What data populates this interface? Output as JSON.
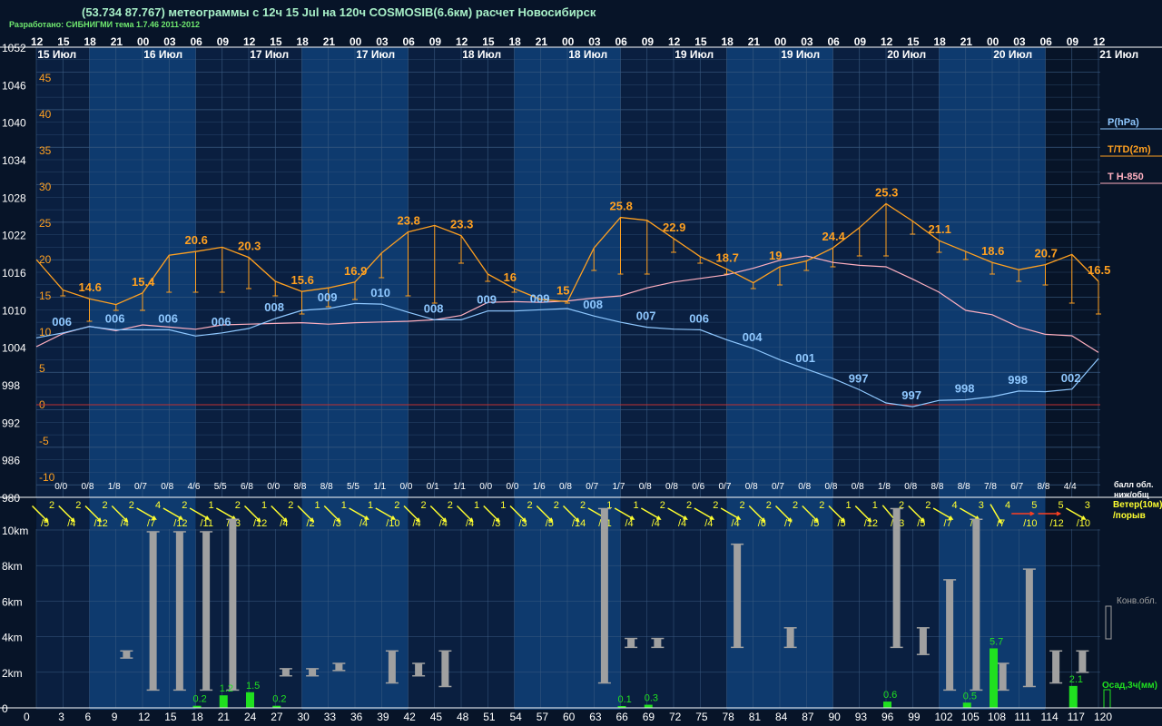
{
  "header": {
    "title": "(53.734 87.767) метеограммы с  12ч 15 Jul на 120ч COSMOSIB(6.6км) расчет Новосибирск",
    "subtitle": "Разработано: СИБНИГМИ тема 1.7.46 2011-2012"
  },
  "colors": {
    "background": "#071428",
    "band_light": "#0e3a6e",
    "band_dark": "#0a1f40",
    "pressure": "#8fc8ff",
    "temperature": "#ffa020",
    "t850": "#ffb0c0",
    "zero_line": "#c03030",
    "grid": "#3a5a80",
    "wind_yellow": "#ffff30",
    "wind_red": "#ff4020",
    "cloud": "#a0a0a0",
    "precip": "#20e020"
  },
  "chart_data": {
    "type": "line",
    "hour_ticks": [
      "12",
      "15",
      "18",
      "21",
      "00",
      "03",
      "06",
      "09",
      "12",
      "15",
      "18",
      "21",
      "00",
      "03",
      "06",
      "09",
      "12",
      "15",
      "18",
      "21",
      "00",
      "03",
      "06",
      "09",
      "12",
      "15",
      "18",
      "21",
      "00",
      "03",
      "06",
      "09",
      "12",
      "15",
      "18",
      "21",
      "00",
      "03",
      "06",
      "09",
      "12"
    ],
    "date_labels": [
      "15 Июл",
      "16 Июл",
      "17 Июл",
      "17 Июл",
      "18 Июл",
      "18 Июл",
      "19 Июл",
      "19 Июл",
      "20 Июл",
      "20 Июл",
      "21 Июл"
    ],
    "pressure_axis": {
      "ticks": [
        1052,
        1046,
        1040,
        1034,
        1028,
        1022,
        1016,
        1010,
        1004,
        998,
        992,
        986,
        980
      ],
      "range": [
        980,
        1052
      ]
    },
    "temperature_axis": {
      "ticks": [
        45,
        40,
        35,
        30,
        25,
        20,
        15,
        10,
        5,
        0,
        -5,
        -10
      ],
      "range": [
        -10,
        45
      ]
    },
    "lead_hours": [
      0,
      3,
      6,
      9,
      12,
      15,
      18,
      21,
      24,
      27,
      30,
      33,
      36,
      39,
      42,
      45,
      48,
      51,
      54,
      57,
      60,
      63,
      66,
      69,
      72,
      75,
      78,
      81,
      84,
      87,
      90,
      93,
      96,
      99,
      102,
      105,
      108,
      111,
      114,
      117,
      120
    ],
    "legend": [
      "P(hPa)",
      "T/TD(2m)",
      "T H-850"
    ],
    "series": [
      {
        "name": "P(hPa)",
        "values": [
          1005.5,
          1006.3,
          1007.3,
          1006.8,
          1006.8,
          1006.8,
          1005.8,
          1006.3,
          1007.0,
          1008.6,
          1009.9,
          1010.2,
          1011.0,
          1010.9,
          1009.6,
          1008.4,
          1008.4,
          1009.8,
          1009.8,
          1010.0,
          1010.2,
          1009.0,
          1008.0,
          1007.2,
          1006.9,
          1006.8,
          1005.2,
          1003.8,
          1002.0,
          1000.5,
          999.0,
          997.2,
          995.1,
          994.5,
          995.5,
          995.6,
          996.1,
          997.0,
          996.9,
          997.3,
          1002.2,
          1005.5
        ]
      },
      {
        "name": "T/TD(2m)",
        "values": [
          20.0,
          15.8,
          14.6,
          13.8,
          15.4,
          20.6,
          21.1,
          21.7,
          20.3,
          17.0,
          15.6,
          16.1,
          16.9,
          20.9,
          23.8,
          24.7,
          23.3,
          18.0,
          16.0,
          14.5,
          14.2,
          21.6,
          25.8,
          25.4,
          22.9,
          20.4,
          18.7,
          16.8,
          19.0,
          19.8,
          21.6,
          24.4,
          27.7,
          25.3,
          22.6,
          21.1,
          19.6,
          18.6,
          19.3,
          20.7,
          17.0,
          16.5
        ]
      },
      {
        "name": "TD(2m)",
        "values": [
          null,
          15.0,
          11.5,
          13.0,
          13.0,
          15.5,
          15.5,
          15.5,
          16.0,
          15.0,
          12.5,
          13.5,
          14.5,
          17.5,
          15.0,
          14.0,
          19.5,
          17.0,
          15.5,
          14.5,
          14.0,
          18.5,
          18.0,
          18.0,
          21.0,
          19.5,
          18.0,
          16.0,
          16.5,
          18.5,
          19.0,
          20.5,
          20.5,
          23.5,
          21.0,
          20.0,
          18.0,
          17.0,
          16.5,
          14.0,
          12.5,
          12.5
        ]
      },
      {
        "name": "T H-850",
        "values": [
          8.0,
          9.8,
          10.8,
          10.2,
          11.0,
          10.7,
          10.4,
          11.0,
          11.1,
          11.2,
          11.3,
          11.1,
          11.3,
          11.4,
          11.5,
          11.7,
          12.3,
          14.1,
          14.2,
          14.1,
          14.3,
          14.7,
          15.0,
          16.1,
          16.9,
          17.4,
          17.9,
          18.8,
          19.9,
          20.5,
          19.6,
          19.2,
          19.0,
          17.3,
          15.5,
          13.0,
          12.4,
          10.7,
          9.7,
          9.5,
          7.2,
          6.8
        ]
      }
    ],
    "pressure_labels": [
      {
        "h": 3,
        "t": "006"
      },
      {
        "h": 9,
        "t": "006"
      },
      {
        "h": 15,
        "t": "006"
      },
      {
        "h": 21,
        "t": "006"
      },
      {
        "h": 27,
        "t": "008"
      },
      {
        "h": 33,
        "t": "009"
      },
      {
        "h": 39,
        "t": "010"
      },
      {
        "h": 45,
        "t": "008"
      },
      {
        "h": 51,
        "t": "009"
      },
      {
        "h": 57,
        "t": "009"
      },
      {
        "h": 63,
        "t": "008"
      },
      {
        "h": 69,
        "t": "007"
      },
      {
        "h": 75,
        "t": "006"
      },
      {
        "h": 81,
        "t": "004"
      },
      {
        "h": 87,
        "t": "001"
      },
      {
        "h": 93,
        "t": "997"
      },
      {
        "h": 99,
        "t": "997"
      },
      {
        "h": 105,
        "t": "998"
      },
      {
        "h": 111,
        "t": "998"
      },
      {
        "h": 117,
        "t": "002"
      }
    ],
    "temperature_labels": [
      {
        "h": 6,
        "t": "14.6"
      },
      {
        "h": 12,
        "t": "15.4"
      },
      {
        "h": 18,
        "t": "20.6"
      },
      {
        "h": 24,
        "t": "20.3"
      },
      {
        "h": 30,
        "t": "15.6"
      },
      {
        "h": 36,
        "t": "16.9"
      },
      {
        "h": 42,
        "t": "23.8"
      },
      {
        "h": 48,
        "t": "23.3"
      },
      {
        "h": 54,
        "t": "16"
      },
      {
        "h": 60,
        "t": "15"
      },
      {
        "h": 66,
        "t": "25.8"
      },
      {
        "h": 72,
        "t": "22.9"
      },
      {
        "h": 78,
        "t": "18.7"
      },
      {
        "h": 84,
        "t": "19"
      },
      {
        "h": 90,
        "t": "24.4"
      },
      {
        "h": 96,
        "t": "25.3"
      },
      {
        "h": 102,
        "t": "21.1"
      },
      {
        "h": 108,
        "t": "18.6"
      },
      {
        "h": 114,
        "t": "20.7"
      },
      {
        "h": 120,
        "t": "16.5"
      }
    ],
    "cloud_cover_label": "балл обл.\nниж/общ",
    "cloud_cover": [
      "0/0",
      "0/8",
      "1/8",
      "0/7",
      "0/8",
      "4/6",
      "5/5",
      "6/8",
      "0/0",
      "8/8",
      "8/8",
      "5/5",
      "1/1",
      "0/0",
      "0/1",
      "1/1",
      "0/0",
      "0/0",
      "1/6",
      "0/8",
      "0/7",
      "1/7",
      "0/8",
      "0/8",
      "0/6",
      "0/7",
      "0/8",
      "0/7",
      "0/8",
      "0/8",
      "0/8",
      "1/8",
      "0/8",
      "8/8",
      "8/8",
      "7/8",
      "6/7",
      "8/8",
      "4/4"
    ],
    "wind_label": "Ветер(10м)\n/порыв",
    "wind": [
      {
        "s": "2",
        "g": "/5",
        "d": 315
      },
      {
        "s": "2",
        "g": "/4",
        "d": 315
      },
      {
        "s": "2",
        "g": "/12",
        "d": 315
      },
      {
        "s": "2",
        "g": "/4",
        "d": 315
      },
      {
        "s": "4",
        "g": "/7",
        "d": 300
      },
      {
        "s": "2",
        "g": "/12",
        "d": 300
      },
      {
        "s": "1",
        "g": "/11",
        "d": 300
      },
      {
        "s": "2",
        "g": "/13",
        "d": 300
      },
      {
        "s": "1",
        "g": "/12",
        "d": 315
      },
      {
        "s": "2",
        "g": "/4",
        "d": 315
      },
      {
        "s": "1",
        "g": "/2",
        "d": 315
      },
      {
        "s": "1",
        "g": "/3",
        "d": 315
      },
      {
        "s": "1",
        "g": "/4",
        "d": 300
      },
      {
        "s": "2",
        "g": "/10",
        "d": 300
      },
      {
        "s": "2",
        "g": "/4",
        "d": 315
      },
      {
        "s": "2",
        "g": "/4",
        "d": 315
      },
      {
        "s": "1",
        "g": "/4",
        "d": 315
      },
      {
        "s": "1",
        "g": "/3",
        "d": 315
      },
      {
        "s": "2",
        "g": "/3",
        "d": 315
      },
      {
        "s": "2",
        "g": "/5",
        "d": 315
      },
      {
        "s": "2",
        "g": "/14",
        "d": 315
      },
      {
        "s": "1",
        "g": "/11",
        "d": 300
      },
      {
        "s": "1",
        "g": "/4",
        "d": 300
      },
      {
        "s": "2",
        "g": "/4",
        "d": 300
      },
      {
        "s": "2",
        "g": "/4",
        "d": 300
      },
      {
        "s": "2",
        "g": "/4",
        "d": 300
      },
      {
        "s": "2",
        "g": "/4",
        "d": 300
      },
      {
        "s": "2",
        "g": "/6",
        "d": 315
      },
      {
        "s": "2",
        "g": "/7",
        "d": 315
      },
      {
        "s": "2",
        "g": "/5",
        "d": 315
      },
      {
        "s": "1",
        "g": "/5",
        "d": 315
      },
      {
        "s": "1",
        "g": "/12",
        "d": 315
      },
      {
        "s": "2",
        "g": "/13",
        "d": 320
      },
      {
        "s": "2",
        "g": "/5",
        "d": 315
      },
      {
        "s": "4",
        "g": "/7",
        "d": 300
      },
      {
        "s": "3",
        "g": "/7",
        "d": 300
      },
      {
        "s": "4",
        "g": "/7",
        "d": 330
      },
      {
        "s": "5",
        "g": "/10",
        "d": 270,
        "red": true
      },
      {
        "s": "5",
        "g": "/12",
        "d": 270,
        "red": true
      },
      {
        "s": "3",
        "g": "/10",
        "d": 300
      }
    ],
    "height_axis": {
      "ticks": [
        "10km",
        "8km",
        "6km",
        "4km",
        "2km",
        "0"
      ],
      "max_km": 11
    },
    "convective_clouds_label": "Конв.обл.",
    "convective_clouds": [
      {
        "h": 12,
        "b": 2.8,
        "t": 3.2
      },
      {
        "h": 15,
        "b": 1.0,
        "t": 9.9
      },
      {
        "h": 18,
        "b": 1.0,
        "t": 9.9
      },
      {
        "h": 21,
        "b": 1.0,
        "t": 9.9
      },
      {
        "h": 24,
        "b": 1.0,
        "t": 10.6
      },
      {
        "h": 30,
        "b": 1.8,
        "t": 2.2
      },
      {
        "h": 33,
        "b": 1.8,
        "t": 2.2
      },
      {
        "h": 36,
        "b": 2.1,
        "t": 2.5
      },
      {
        "h": 42,
        "b": 1.4,
        "t": 3.2
      },
      {
        "h": 45,
        "b": 1.8,
        "t": 2.5
      },
      {
        "h": 48,
        "b": 1.2,
        "t": 3.2
      },
      {
        "h": 66,
        "b": 1.4,
        "t": 11.2
      },
      {
        "h": 69,
        "b": 3.4,
        "t": 3.9
      },
      {
        "h": 72,
        "b": 3.4,
        "t": 3.9
      },
      {
        "h": 81,
        "b": 3.4,
        "t": 9.2
      },
      {
        "h": 87,
        "b": 3.4,
        "t": 4.5
      },
      {
        "h": 99,
        "b": 3.4,
        "t": 11.2
      },
      {
        "h": 102,
        "b": 3.0,
        "t": 4.5
      },
      {
        "h": 105,
        "b": 1.0,
        "t": 7.2
      },
      {
        "h": 108,
        "b": 1.0,
        "t": 10.6
      },
      {
        "h": 111,
        "b": 1.0,
        "t": 2.5
      },
      {
        "h": 114,
        "b": 1.2,
        "t": 7.8
      },
      {
        "h": 117,
        "b": 1.4,
        "t": 3.2
      },
      {
        "h": 120,
        "b": 2.0,
        "t": 3.2
      }
    ],
    "precip_label": "Осад,3ч(мм)",
    "precipitation": [
      {
        "h": 21,
        "v": 0.2
      },
      {
        "h": 24,
        "v": 1.2
      },
      {
        "h": 27,
        "v": 1.5
      },
      {
        "h": 30,
        "v": 0.2
      },
      {
        "h": 69,
        "v": 0.1
      },
      {
        "h": 72,
        "v": 0.3
      },
      {
        "h": 99,
        "v": 0.6
      },
      {
        "h": 108,
        "v": 0.5
      },
      {
        "h": 111,
        "v": 5.7
      },
      {
        "h": 120,
        "v": 2.1
      }
    ],
    "lead_time_axis": [
      "0",
      "3",
      "6",
      "9",
      "12",
      "15",
      "18",
      "21",
      "24",
      "27",
      "30",
      "33",
      "36",
      "39",
      "42",
      "45",
      "48",
      "51",
      "54",
      "57",
      "60",
      "63",
      "66",
      "69",
      "72",
      "75",
      "78",
      "81",
      "84",
      "87",
      "90",
      "93",
      "96",
      "99",
      "102",
      "105",
      "108",
      "111",
      "114",
      "117",
      "120"
    ]
  }
}
